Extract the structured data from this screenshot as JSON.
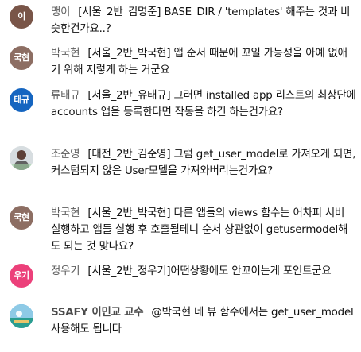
{
  "chat": {
    "messages": [
      {
        "author": "맹이",
        "avatar_text": "이",
        "avatar_color": "#795548",
        "text": "[서울_2반_김명준] BASE_DIR / 'templates' 해주는 것과 비슷한건가요..?"
      },
      {
        "author": "박국현",
        "avatar_text": "국현",
        "avatar_color": "#8d6e63",
        "text": "[서울_2반_박국현] 앱 순서 때문에 꼬일 가능성을 아예 없애기 위해 저렇게 하는 거군요"
      },
      {
        "author": "류태규",
        "avatar_text": "태규",
        "avatar_color": "#1565c0",
        "text": "[서울_2반_유태규] 그러면 installed app 리스트의 최상단에 accounts 앱을 등록한다면 작동을 하긴 하는건가요?"
      },
      {
        "author": "조준영",
        "avatar_text": "",
        "avatar_color": "#bdbdbd",
        "text": "[대전_2반_김준영] 그럼 get_user_model로 가져오게 되면, 커스텀되지 않은 User모델을 가져와버리는건가요?"
      },
      {
        "author": "박국현",
        "avatar_text": "국현",
        "avatar_color": "#8d6e63",
        "text": "[서울_2반_박국현] 다른 앱들의 views 함수는 어차피 서버 실행하고 앱들 실행 후 호출될테니 순서 상관없이 getusermodel해도 되는 것 맞나요?"
      },
      {
        "author": "정우기",
        "avatar_text": "우기",
        "avatar_color": "#ec407a",
        "text": "[서울_2반_정우기]어떤상황에도 안꼬이는게 포인트군요"
      },
      {
        "author": "SSAFY 이민교 교수",
        "avatar_text": "",
        "avatar_color": "#4aa3df",
        "text": "@박국현 네 뷰 함수에서는 get_user_model 사용해도 됩니다"
      }
    ]
  }
}
